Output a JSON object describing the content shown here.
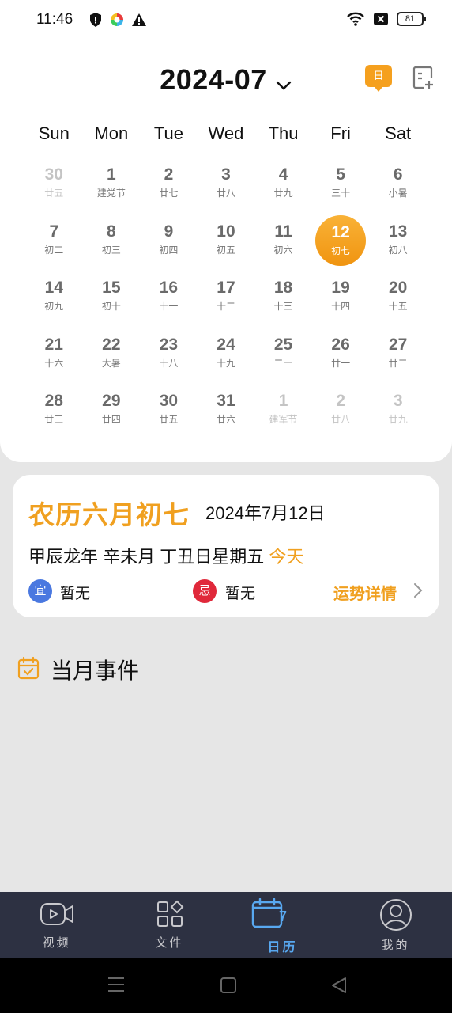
{
  "status_bar": {
    "time": "11:46",
    "battery": "81"
  },
  "header": {
    "month": "2024-07",
    "day_view_label": "日"
  },
  "weekdays": [
    "Sun",
    "Mon",
    "Tue",
    "Wed",
    "Thu",
    "Fri",
    "Sat"
  ],
  "calendar": {
    "rows": [
      [
        {
          "d": "30",
          "l": "廿五",
          "o": true
        },
        {
          "d": "1",
          "l": "建党节"
        },
        {
          "d": "2",
          "l": "廿七"
        },
        {
          "d": "3",
          "l": "廿八"
        },
        {
          "d": "4",
          "l": "廿九"
        },
        {
          "d": "5",
          "l": "三十"
        },
        {
          "d": "6",
          "l": "小暑"
        }
      ],
      [
        {
          "d": "7",
          "l": "初二"
        },
        {
          "d": "8",
          "l": "初三"
        },
        {
          "d": "9",
          "l": "初四"
        },
        {
          "d": "10",
          "l": "初五"
        },
        {
          "d": "11",
          "l": "初六"
        },
        {
          "d": "12",
          "l": "初七",
          "s": true
        },
        {
          "d": "13",
          "l": "初八"
        }
      ],
      [
        {
          "d": "14",
          "l": "初九"
        },
        {
          "d": "15",
          "l": "初十"
        },
        {
          "d": "16",
          "l": "十一"
        },
        {
          "d": "17",
          "l": "十二"
        },
        {
          "d": "18",
          "l": "十三"
        },
        {
          "d": "19",
          "l": "十四"
        },
        {
          "d": "20",
          "l": "十五"
        }
      ],
      [
        {
          "d": "21",
          "l": "十六"
        },
        {
          "d": "22",
          "l": "大暑"
        },
        {
          "d": "23",
          "l": "十八"
        },
        {
          "d": "24",
          "l": "十九"
        },
        {
          "d": "25",
          "l": "二十"
        },
        {
          "d": "26",
          "l": "廿一"
        },
        {
          "d": "27",
          "l": "廿二"
        }
      ],
      [
        {
          "d": "28",
          "l": "廿三"
        },
        {
          "d": "29",
          "l": "廿四"
        },
        {
          "d": "30",
          "l": "廿五"
        },
        {
          "d": "31",
          "l": "廿六"
        },
        {
          "d": "1",
          "l": "建军节",
          "o": true
        },
        {
          "d": "2",
          "l": "廿八",
          "o": true
        },
        {
          "d": "3",
          "l": "廿九",
          "o": true
        }
      ]
    ]
  },
  "lunar_card": {
    "title": "农历六月初七",
    "date": "2024年7月12日",
    "ganzhi": "甲辰龙年 辛未月 丁丑日星期五",
    "today": "今天",
    "yi_badge": "宜",
    "yi_text": "暂无",
    "ji_badge": "忌",
    "ji_text": "暂无",
    "fortune_link": "运势详情"
  },
  "events": {
    "title": "当月事件"
  },
  "bottom_nav": {
    "video": "视频",
    "files": "文件",
    "calendar": "日历",
    "calendar_icon_day": "7",
    "mine": "我的"
  },
  "colors": {
    "accent": "#f0a020",
    "nav_bg": "#2d3142",
    "nav_active": "#58a8f0",
    "yi": "#4a78e0",
    "ji": "#e0283a"
  }
}
